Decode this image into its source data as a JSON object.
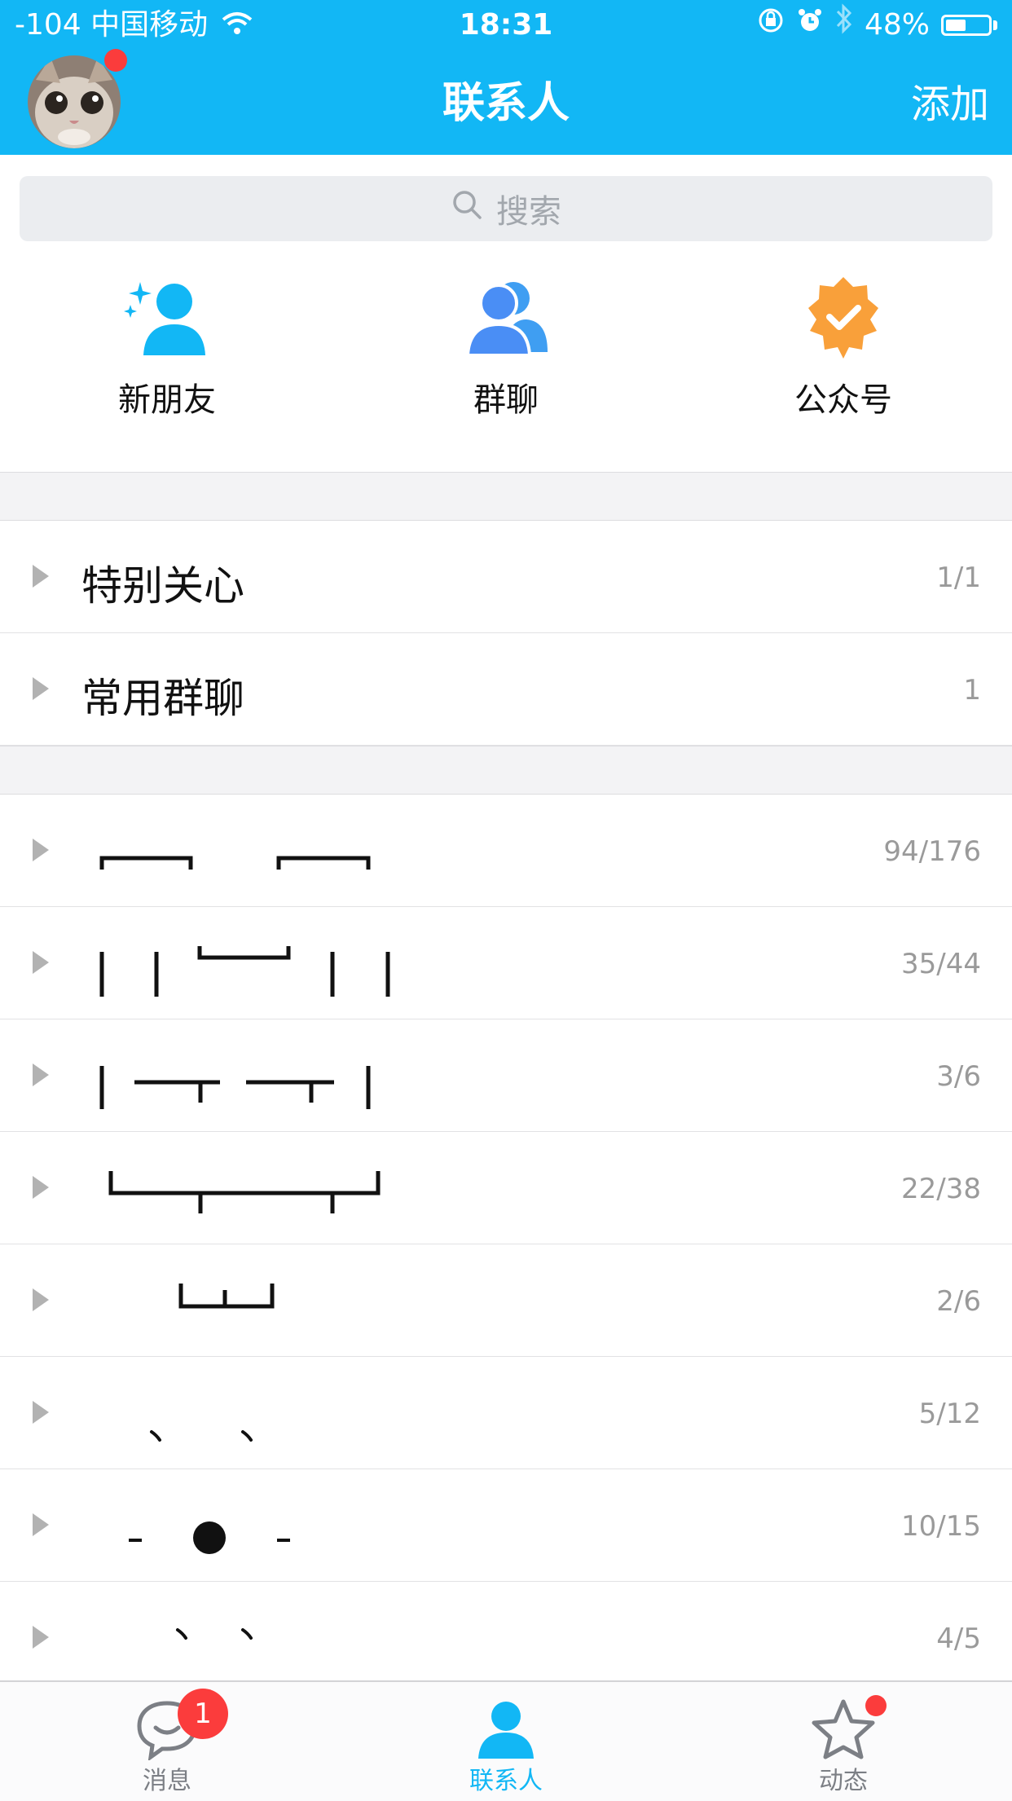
{
  "status_bar": {
    "carrier": "-104 中国移动",
    "time": "18:31",
    "battery": "48%",
    "battery_level": 0.48
  },
  "header": {
    "title": "联系人",
    "add_label": "添加"
  },
  "search": {
    "placeholder": "搜索"
  },
  "quick_actions": [
    {
      "label": "新朋友",
      "icon": "new-friend-icon"
    },
    {
      "label": "群聊",
      "icon": "group-chat-icon"
    },
    {
      "label": "公众号",
      "icon": "official-account-icon"
    }
  ],
  "pinned_groups": [
    {
      "label": "特别关心",
      "count": "1/1"
    },
    {
      "label": "常用群聊",
      "count": "1"
    }
  ],
  "friend_groups": [
    {
      "label": "┌─┐　┌─┐",
      "count": "94/176"
    },
    {
      "label": "│　│└─┘│　│",
      "count": "35/44"
    },
    {
      "label": "│─┬─┬│",
      "count": "3/6"
    },
    {
      "label": "└─┬──┬┘",
      "count": "22/38"
    },
    {
      "label": "└┴┘",
      "count": "2/6"
    },
    {
      "label": "、　、",
      "count": "5/12"
    },
    {
      "label": "-　●　-",
      "count": "10/15"
    },
    {
      "label": "、　、",
      "count": "4/5"
    }
  ],
  "tabbar": {
    "tabs": [
      {
        "label": "消息",
        "badge": "1"
      },
      {
        "label": "联系人"
      },
      {
        "label": "动态"
      }
    ],
    "active_color": "#12b7f5",
    "inactive_color": "#7c7f85"
  },
  "colors": {
    "brand": "#12b7f5",
    "badge": "#fb3c3c",
    "official_account": "#f9a03a"
  }
}
